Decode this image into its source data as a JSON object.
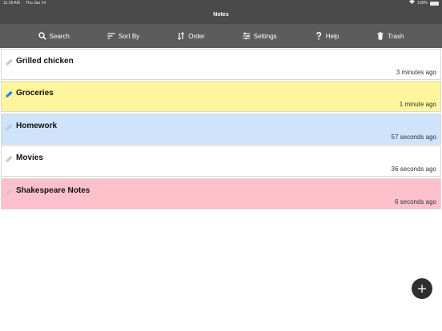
{
  "status_bar": {
    "time": "11:18 AM",
    "date": "Thu Jan 14",
    "battery": "100%"
  },
  "header": {
    "title": "Notes"
  },
  "toolbar": {
    "search_label": "Search",
    "sort_label": "Sort By",
    "order_label": "Order",
    "settings_label": "Settings",
    "help_label": "Help",
    "trash_label": "Trash"
  },
  "notes": [
    {
      "title": "Grilled chicken",
      "time": "3 minutes ago",
      "color": "#ffffff",
      "pin_color": "#c8c8c8"
    },
    {
      "title": "Groceries",
      "time": "1 minute ago",
      "color": "#fff59d",
      "pin_color": "#1e88e5"
    },
    {
      "title": "Homework",
      "time": "57 seconds ago",
      "color": "#cfe3fb",
      "pin_color": "#c8c8c8"
    },
    {
      "title": "Movies",
      "time": "36 seconds ago",
      "color": "#ffffff",
      "pin_color": "#c8c8c8"
    },
    {
      "title": "Shakespeare Notes",
      "time": "6 seconds ago",
      "color": "#fec1cc",
      "pin_color": "#c8c8c8"
    }
  ],
  "colors": {
    "header_bg": "#4a4a4a",
    "toolbar_bg": "#5c5c5c",
    "fab_bg": "#2f2f2f"
  }
}
